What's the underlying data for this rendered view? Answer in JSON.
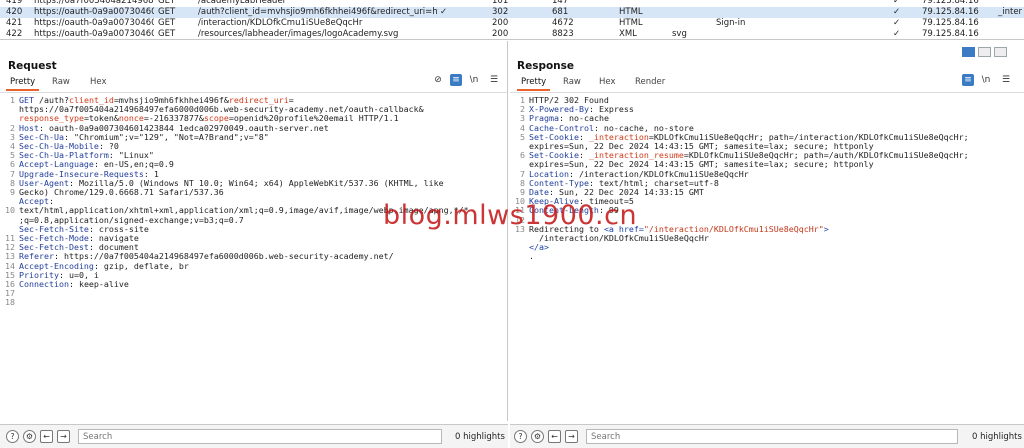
{
  "history": [
    {
      "num": "419",
      "host": "https://0a7f005404a214968...",
      "method": "GET",
      "url": "/academyLabHeader",
      "check1": "",
      "status": "101",
      "length": "147",
      "mime": "",
      "ext": "",
      "title": "",
      "check2": "✓",
      "ip": "79.125.84.16",
      "extra": ""
    },
    {
      "num": "420",
      "host": "https://oauth-0a9a00730460...",
      "method": "GET",
      "url": "/auth?client_id=mvhsjio9mh6fkhhei496f&redirect_uri=https:...",
      "check1": "✓",
      "status": "302",
      "length": "681",
      "mime": "HTML",
      "ext": "",
      "title": "",
      "check2": "✓",
      "ip": "79.125.84.16",
      "extra": "_inter"
    },
    {
      "num": "421",
      "host": "https://oauth-0a9a00730460...",
      "method": "GET",
      "url": "/interaction/KDLOfkCmu1iSUe8eQqcHr",
      "check1": "",
      "status": "200",
      "length": "4672",
      "mime": "HTML",
      "ext": "",
      "title": "Sign-in",
      "check2": "✓",
      "ip": "79.125.84.16",
      "extra": ""
    },
    {
      "num": "422",
      "host": "https://oauth-0a9a00730460...",
      "method": "GET",
      "url": "/resources/labheader/images/logoAcademy.svg",
      "check1": "",
      "status": "200",
      "length": "8823",
      "mime": "XML",
      "ext": "svg",
      "title": "",
      "check2": "✓",
      "ip": "79.125.84.16",
      "extra": ""
    }
  ],
  "request": {
    "title": "Request",
    "tabs": [
      "Pretty",
      "Raw",
      "Hex"
    ],
    "line_numbers": [
      "1",
      "",
      "",
      "2",
      "3",
      "4",
      "5",
      "6",
      "7",
      "8",
      "9",
      "",
      "10",
      "",
      "",
      "11",
      "12",
      "13",
      "14",
      "15",
      "16",
      "17",
      "18"
    ],
    "search_placeholder": "Search",
    "highlights": "0 highlights"
  },
  "response": {
    "title": "Response",
    "tabs": [
      "Pretty",
      "Raw",
      "Hex",
      "Render"
    ],
    "line_numbers": [
      "1",
      "2",
      "3",
      "4",
      "5",
      "",
      "6",
      "",
      "7",
      "8",
      "9",
      "10",
      "11",
      "12",
      "13",
      "",
      "",
      ""
    ],
    "search_placeholder": "Search",
    "highlights": "0 highlights"
  },
  "request_lines": [
    {
      "k": "GET ",
      "v": "/auth?",
      "p": "client_id",
      "e": "=mvhsjio9mh6fkhhei496f&",
      "p2": "redirect_uri",
      "e2": "="
    },
    {
      "raw": "https://0a7f005404a214968497efa6000d006b.web-security-academy.net/oauth-callback&"
    },
    {
      "p": "response_type",
      "e": "=token&",
      "p2": "nonce",
      "e2": "=-216337877&",
      "p3": "scope",
      "e3": "=openid%20profile%20email HTTP/1.1"
    },
    {
      "k": "Host",
      "v": ": oauth-0a9a007304601423844 1edca02970049.oauth-server.net"
    },
    {
      "k": "Sec-Ch-Ua",
      "v": ": \"Chromium\";v=\"129\", \"Not=A?Brand\";v=\"8\""
    },
    {
      "k": "Sec-Ch-Ua-Mobile",
      "v": ": ?0"
    },
    {
      "k": "Sec-Ch-Ua-Platform",
      "v": ": \"Linux\""
    },
    {
      "k": "Accept-Language",
      "v": ": en-US,en;q=0.9"
    },
    {
      "k": "Upgrade-Insecure-Requests",
      "v": ": 1"
    },
    {
      "k": "User-Agent",
      "v": ": Mozilla/5.0 (Windows NT 10.0; Win64; x64) AppleWebKit/537.36 (KHTML, like"
    },
    {
      "raw": "Gecko) Chrome/129.0.6668.71 Safari/537.36"
    },
    {
      "k": "Accept",
      "v": ":"
    },
    {
      "raw": "text/html,application/xhtml+xml,application/xml;q=0.9,image/avif,image/webp,image/apng,*/*"
    },
    {
      "raw": ";q=0.8,application/signed-exchange;v=b3;q=0.7"
    },
    {
      "k": "Sec-Fetch-Site",
      "v": ": cross-site"
    },
    {
      "k": "Sec-Fetch-Mode",
      "v": ": navigate"
    },
    {
      "k": "Sec-Fetch-Dest",
      "v": ": document"
    },
    {
      "k": "Referer",
      "v": ": https://0a7f005404a214968497efa6000d006b.web-security-academy.net/"
    },
    {
      "k": "Accept-Encoding",
      "v": ": gzip, deflate, br"
    },
    {
      "k": "Priority",
      "v": ": u=0, i"
    },
    {
      "k": "Connection",
      "v": ": keep-alive"
    },
    {
      "raw": ""
    },
    {
      "raw": ""
    }
  ],
  "response_lines": [
    {
      "raw": "HTTP/2 302 Found"
    },
    {
      "k": "X-Powered-By",
      "v": ": Express"
    },
    {
      "k": "Pragma",
      "v": ": no-cache"
    },
    {
      "k": "Cache-Control",
      "v": ": no-cache, no-store"
    },
    {
      "k": "Set-Cookie",
      "v": ": ",
      "p": "_interaction",
      "e": "=KDLOfkCmu1iSUe8eQqcHr; path=/interaction/KDLOfkCmu1iSUe8eQqcHr;"
    },
    {
      "raw": "expires=Sun, 22 Dec 2024 14:43:15 GMT; samesite=lax; secure; httponly"
    },
    {
      "k": "Set-Cookie",
      "v": ": ",
      "p": "_interaction_resume",
      "e": "=KDLOfkCmu1iSUe8eQqcHr; path=/auth/KDLOfkCmu1iSUe8eQqcHr;"
    },
    {
      "raw": "expires=Sun, 22 Dec 2024 14:43:15 GMT; samesite=lax; secure; httponly"
    },
    {
      "k": "Location",
      "v": ": /interaction/KDLOfkCmu1iSUe8eQqcHr"
    },
    {
      "k": "Content-Type",
      "v": ": text/html; charset=utf-8"
    },
    {
      "k": "Date",
      "v": ": Sun, 22 Dec 2024 14:33:15 GMT"
    },
    {
      "k": "Keep-Alive",
      "v": ": timeout=5"
    },
    {
      "k": "Content-Length",
      "v": ": 99"
    },
    {
      "raw": ""
    },
    {
      "raw": "Redirecting to ",
      "tag": "<a href=",
      "attr": "\"/interaction/KDLOfkCmu1iSUe8eQqcHr\"",
      "tag2": ">"
    },
    {
      "raw": "  /interaction/KDLOfkCmu1iSUe8eQqcHr"
    },
    {
      "tag": "</a>"
    },
    {
      "raw": "."
    }
  ],
  "watermark": "blog.mlws1900.cn",
  "colors": {
    "accent": "#e8622b",
    "selection": "#d6e6f7",
    "header_key": "#233f9a",
    "param": "#d23a1a",
    "watermark": "#c31414"
  }
}
